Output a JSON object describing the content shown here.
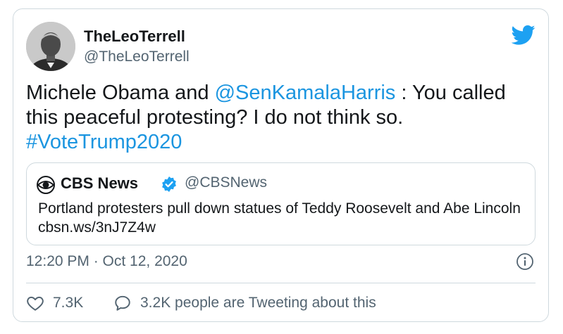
{
  "tweet": {
    "display_name": "TheLeoTerrell",
    "handle": "@TheLeoTerrell",
    "text_part1": "Michele Obama and ",
    "mention": "@SenKamalaHarris",
    "text_part2": " : You called this peaceful protesting?  I do not think so. ",
    "hashtag": "#VoteTrump2020",
    "timestamp": "12:20 PM · Oct 12, 2020"
  },
  "quoted_tweet": {
    "display_name": "CBS News",
    "handle": "@CBSNews",
    "text": "Portland protesters pull down statues of Teddy Roosevelt and Abe Lincoln  cbsn.ws/3nJ7Z4w"
  },
  "actions": {
    "like_count": "7.3K",
    "conversation_text": "3.2K people are Tweeting about this"
  },
  "colors": {
    "link": "#1b95e0",
    "secondary_text": "#536471",
    "border": "#cfd9de",
    "verified": "#1da1f2"
  },
  "icons": [
    "twitter-bird-icon",
    "cbs-eye-logo-icon",
    "verified-badge-icon",
    "info-icon",
    "heart-icon",
    "speech-bubble-icon"
  ]
}
